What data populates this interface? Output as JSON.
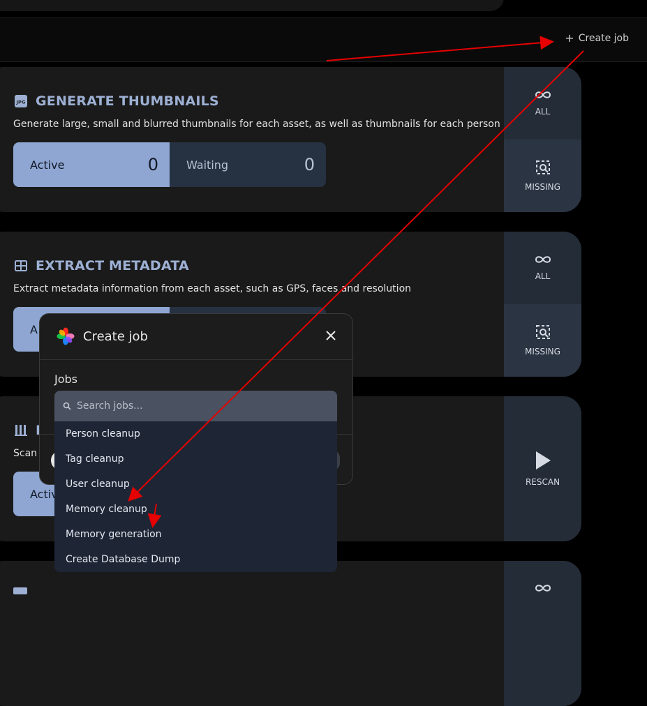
{
  "header": {
    "create_job_label": "Create job"
  },
  "cards": [
    {
      "title": "GENERATE THUMBNAILS",
      "description": "Generate large, small and blurred thumbnails for each asset, as well as thumbnails for each person",
      "active_label": "Active",
      "active_value": "0",
      "waiting_label": "Waiting",
      "waiting_value": "0",
      "side_top": "ALL",
      "side_bottom": "MISSING"
    },
    {
      "title": "EXTRACT METADATA",
      "description": "Extract metadata information from each asset, such as GPS, faces and resolution",
      "active_label": "A",
      "side_top": "ALL",
      "side_bottom": "MISSING"
    },
    {
      "title": "L",
      "description": "Scan",
      "active_label": "Activ",
      "side_full": "RESCAN"
    }
  ],
  "modal": {
    "title": "Create job",
    "jobs_label": "Jobs",
    "search_placeholder": "Search jobs..."
  },
  "dropdown": {
    "options": [
      "Person cleanup",
      "Tag cleanup",
      "User cleanup",
      "Memory cleanup",
      "Memory generation",
      "Create Database Dump"
    ]
  },
  "colors": {
    "accent": "#8ea6d1",
    "title": "#9db0d4",
    "annotation_arrow": "#e60000"
  }
}
